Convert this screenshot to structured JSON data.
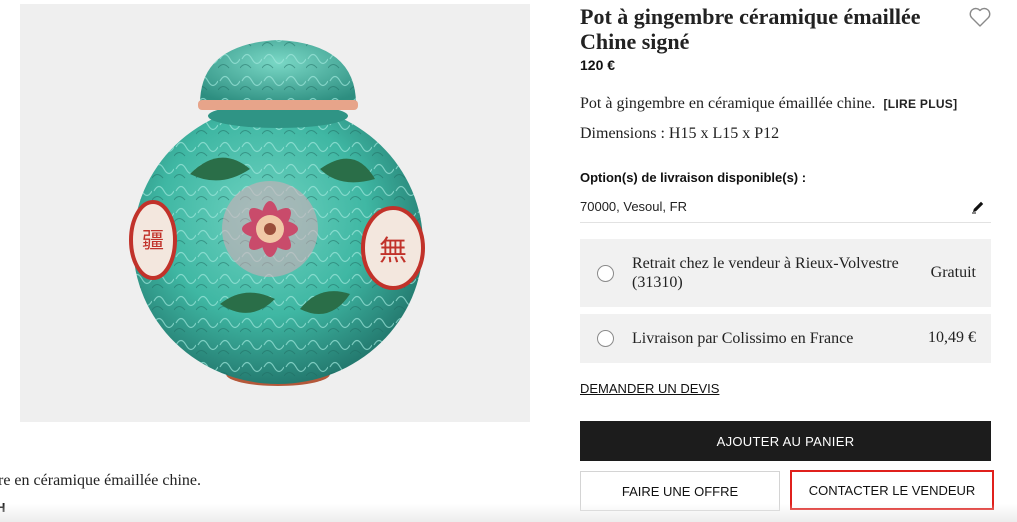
{
  "product": {
    "title": "Pot à gingembre céramique émaillée Chine signé",
    "price": "120 €",
    "short_description": "Pot à gingembre en céramique émaillée chine.",
    "read_more": "[LIRE PLUS]",
    "dimensions": "Dimensions : H15 x L15 x P12"
  },
  "image_panel": {
    "caption_cutoff": "re en céramique émaillée chine.",
    "caption_cutoff_2": "H"
  },
  "shipping": {
    "label": "Option(s) de livraison disponible(s) :",
    "location": "70000, Vesoul, FR",
    "options": [
      {
        "label": "Retrait chez le vendeur à Rieux-Volvestre (31310)",
        "price": "Gratuit"
      },
      {
        "label": "Livraison par Colissimo en France",
        "price": "10,49 €"
      }
    ]
  },
  "actions": {
    "quote": "DEMANDER UN DEVIS",
    "add_to_cart": "AJOUTER AU PANIER",
    "make_offer": "FAIRE UNE OFFRE",
    "contact_seller": "CONTACTER LE VENDEUR"
  },
  "icons": {
    "favorite": "heart-icon",
    "edit": "pencil-icon"
  },
  "colors": {
    "primary_button": "#1c1c1c",
    "highlight": "#e0201c",
    "option_bg": "#f1f1f1"
  }
}
